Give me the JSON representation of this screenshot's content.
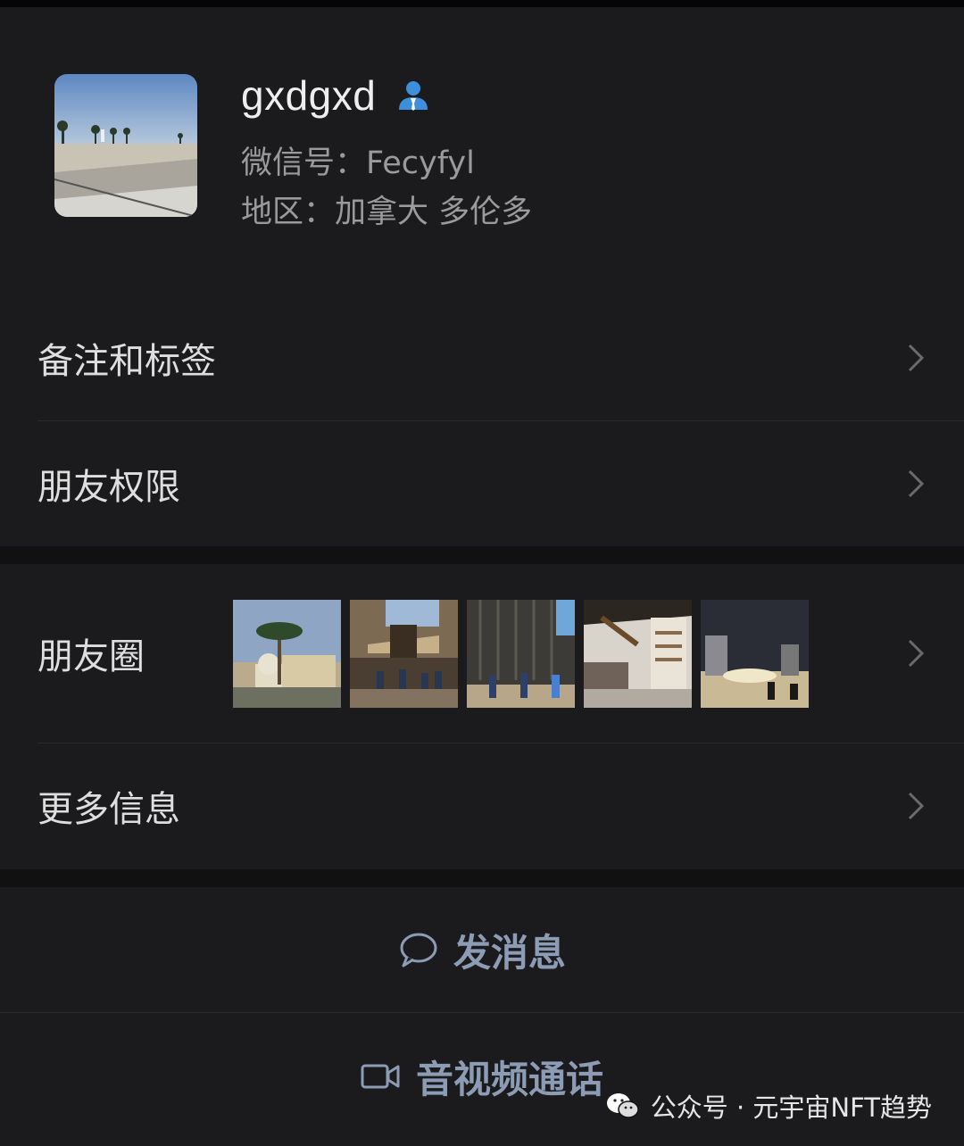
{
  "profile": {
    "name": "gxdgxd",
    "wechat_id_line": "微信号：Fecyfyl",
    "region_line": "地区：加拿大 多伦多",
    "avatar_icon": "beach-photo"
  },
  "menu": {
    "remark_tags": "备注和标签",
    "friend_permissions": "朋友权限",
    "moments": "朋友圈",
    "more_info": "更多信息"
  },
  "actions": {
    "send_message": "发消息",
    "video_call": "音视频通话"
  },
  "watermark": {
    "text": "公众号 · 元宇宙NFT趋势"
  },
  "colors": {
    "background": "#1b1b1d",
    "accent_text": "#8c9cb5",
    "user_badge": "#3d8fdc"
  }
}
